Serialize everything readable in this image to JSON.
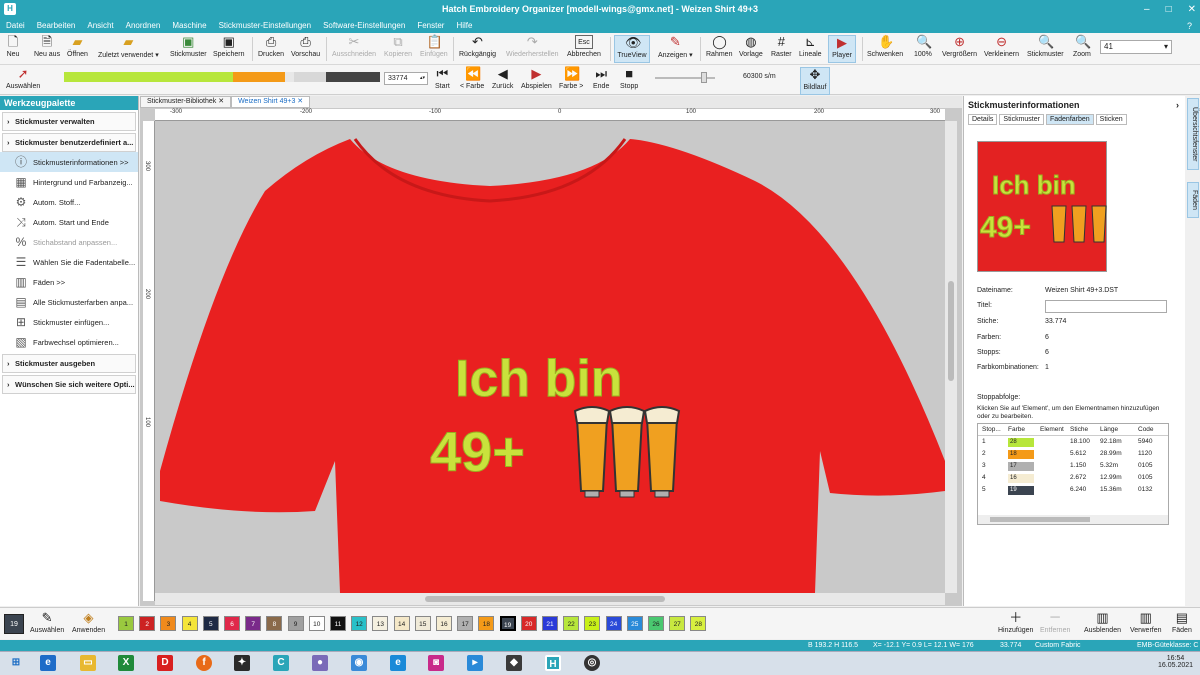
{
  "window": {
    "title": "Hatch Embroidery Organizer [modell-wings@gmx.net] - Weizen Shirt 49+3"
  },
  "menu": [
    "Datei",
    "Bearbeiten",
    "Ansicht",
    "Anordnen",
    "Maschine",
    "Stickmuster-Einstellungen",
    "Software-Einstellungen",
    "Fenster",
    "Hilfe"
  ],
  "toolbar": {
    "neu": "Neu",
    "neu_aus": "Neu aus",
    "offnen": "Öffnen",
    "zuletzt": "Zuletzt verwendet",
    "stickmuster": "Stickmuster",
    "speichern": "Speichern",
    "drucken": "Drucken",
    "vorschau": "Vorschau",
    "ausschneiden": "Ausschneiden",
    "kopieren": "Kopieren",
    "einfugen": "Einfügen",
    "ruckgangig": "Rückgängig",
    "wiederherstellen": "Wiederherstellen",
    "abbrechen": "Abbrechen",
    "trueview": "TrueView",
    "anzeigen": "Anzeigen",
    "rahmen": "Rahmen",
    "vorlage": "Vorlage",
    "raster": "Raster",
    "lineale": "Lineale",
    "player": "Player",
    "schwenken": "Schwenken",
    "zoom100": "100%",
    "vergrossern": "Vergrößern",
    "verkleinern": "Verkleinern",
    "stickmuster2": "Stickmuster",
    "zoom": "Zoom",
    "zoom_value": "41"
  },
  "toolbar2": {
    "auswahlen": "Auswählen",
    "stitch_value": "33774",
    "start": "Start",
    "farbe_back": "< Farbe",
    "zuruck": "Zurück",
    "abspielen": "Abspielen",
    "farbe_fwd": "Farbe >",
    "ende": "Ende",
    "stopp": "Stopp",
    "speed": "60300 s/m",
    "bildlauf": "Bildlauf"
  },
  "left": {
    "title": "Werkzeugpalette",
    "sections": [
      "Stickmuster verwalten",
      "Stickmuster benutzerdefiniert a...",
      "Stickmuster ausgeben",
      "Wünschen Sie sich weitere Opti..."
    ],
    "tools": [
      "Stickmusterinformationen >>",
      "Hintergrund und Farbanzeig...",
      "Autom. Stoff...",
      "Autom. Start und Ende",
      "Stichabstand anpassen...",
      "Wählen Sie die Fadentabelle...",
      "Fäden >>",
      "Alle Stickmusterfarben anpa...",
      "Stickmuster einfügen...",
      "Farbwechsel optimieren..."
    ]
  },
  "tabs": [
    "Stickmuster-Bibliothek",
    "Weizen Shirt 49+3"
  ],
  "ruler": {
    "top": [
      "-300",
      "-200",
      "-100",
      "0",
      "100",
      "200",
      "300"
    ],
    "left": [
      "300",
      "200",
      "100"
    ]
  },
  "design": {
    "line1": "Ich bin",
    "line2": "49+"
  },
  "right": {
    "title": "Stickmusterinformationen",
    "tabs": [
      "Details",
      "Stickmuster",
      "Fadenfarben",
      "Sticken"
    ],
    "preview_line1": "Ich bin",
    "preview_line2": "49+",
    "labels": {
      "dateiname": "Dateiname:",
      "titel": "Titel:",
      "stiche": "Stiche:",
      "farben": "Farben:",
      "stopps": "Stopps:",
      "farbkomb": "Farbkombinationen:",
      "stoppabfolge": "Stoppabfolge:",
      "hint": "Klicken Sie auf 'Element', um den Elementnamen hinzuzufügen oder zu bearbeiten."
    },
    "values": {
      "dateiname": "Weizen Shirt 49+3.DST",
      "stiche": "33.774",
      "farben": "6",
      "stopps": "6",
      "farbkomb": "1"
    },
    "table_head": [
      "Stop...",
      "Farbe",
      "Element",
      "Stiche",
      "Länge",
      "Code"
    ],
    "rows": [
      {
        "stop": "1",
        "farbe": "28",
        "stiche": "18.100",
        "laenge": "92.18m",
        "code": "5940",
        "color": "#b7e63b"
      },
      {
        "stop": "2",
        "farbe": "18",
        "stiche": "5.612",
        "laenge": "28.99m",
        "code": "1120",
        "color": "#f49a18"
      },
      {
        "stop": "3",
        "farbe": "17",
        "stiche": "1.150",
        "laenge": "5.32m",
        "code": "0105",
        "color": "#b0b0b0"
      },
      {
        "stop": "4",
        "farbe": "16",
        "stiche": "2.672",
        "laenge": "12.99m",
        "code": "0105",
        "color": "#f5ecd2"
      },
      {
        "stop": "5",
        "farbe": "19",
        "stiche": "6.240",
        "laenge": "15.36m",
        "code": "0132",
        "color": "#3b4450"
      }
    ]
  },
  "rside": [
    "Übersichtsfenster",
    "Fäden"
  ],
  "palette": {
    "current": "19",
    "auswahlen": "Auswählen",
    "anwenden": "Anwenden",
    "hinzufugen": "Hinzufügen",
    "entfernen": "Entfernen",
    "ausblenden": "Ausblenden",
    "verwerfen": "Verwerfen",
    "faden": "Fäden",
    "colors": [
      {
        "n": "1",
        "c": "#9ac93f"
      },
      {
        "n": "2",
        "c": "#cc2222"
      },
      {
        "n": "3",
        "c": "#f08a1c"
      },
      {
        "n": "4",
        "c": "#f5e53a"
      },
      {
        "n": "5",
        "c": "#1e2a44"
      },
      {
        "n": "6",
        "c": "#e0284a"
      },
      {
        "n": "7",
        "c": "#7a2a8a"
      },
      {
        "n": "8",
        "c": "#8a6a4a"
      },
      {
        "n": "9",
        "c": "#a0a0a0"
      },
      {
        "n": "10",
        "c": "#ffffff"
      },
      {
        "n": "11",
        "c": "#111111"
      },
      {
        "n": "12",
        "c": "#2ac0c8"
      },
      {
        "n": "13",
        "c": "#f5f0e0"
      },
      {
        "n": "14",
        "c": "#f5e8c8"
      },
      {
        "n": "15",
        "c": "#f0ead8"
      },
      {
        "n": "16",
        "c": "#f5ecd2"
      },
      {
        "n": "17",
        "c": "#b0b0b0"
      },
      {
        "n": "18",
        "c": "#f49a18"
      },
      {
        "n": "19",
        "c": "#3b4450"
      },
      {
        "n": "20",
        "c": "#d82828"
      },
      {
        "n": "21",
        "c": "#2a3ad8"
      },
      {
        "n": "22",
        "c": "#b7e63b"
      },
      {
        "n": "23",
        "c": "#c8f018"
      },
      {
        "n": "24",
        "c": "#2a4ad8"
      },
      {
        "n": "25",
        "c": "#2a8ad8"
      },
      {
        "n": "26",
        "c": "#4ac870"
      },
      {
        "n": "27",
        "c": "#c8e840"
      },
      {
        "n": "28",
        "c": "#d8f040"
      }
    ]
  },
  "status": {
    "b": "B 193.2 H 116.5",
    "x": "X= -12.1 Y= 0.9 L= 12.1 W= 176",
    "stitches": "33.774",
    "fabric": "Custom Fabric",
    "emb": "EMB-Güteklasse: C"
  },
  "clock": {
    "time": "16:54",
    "date": "16.05.2021"
  }
}
